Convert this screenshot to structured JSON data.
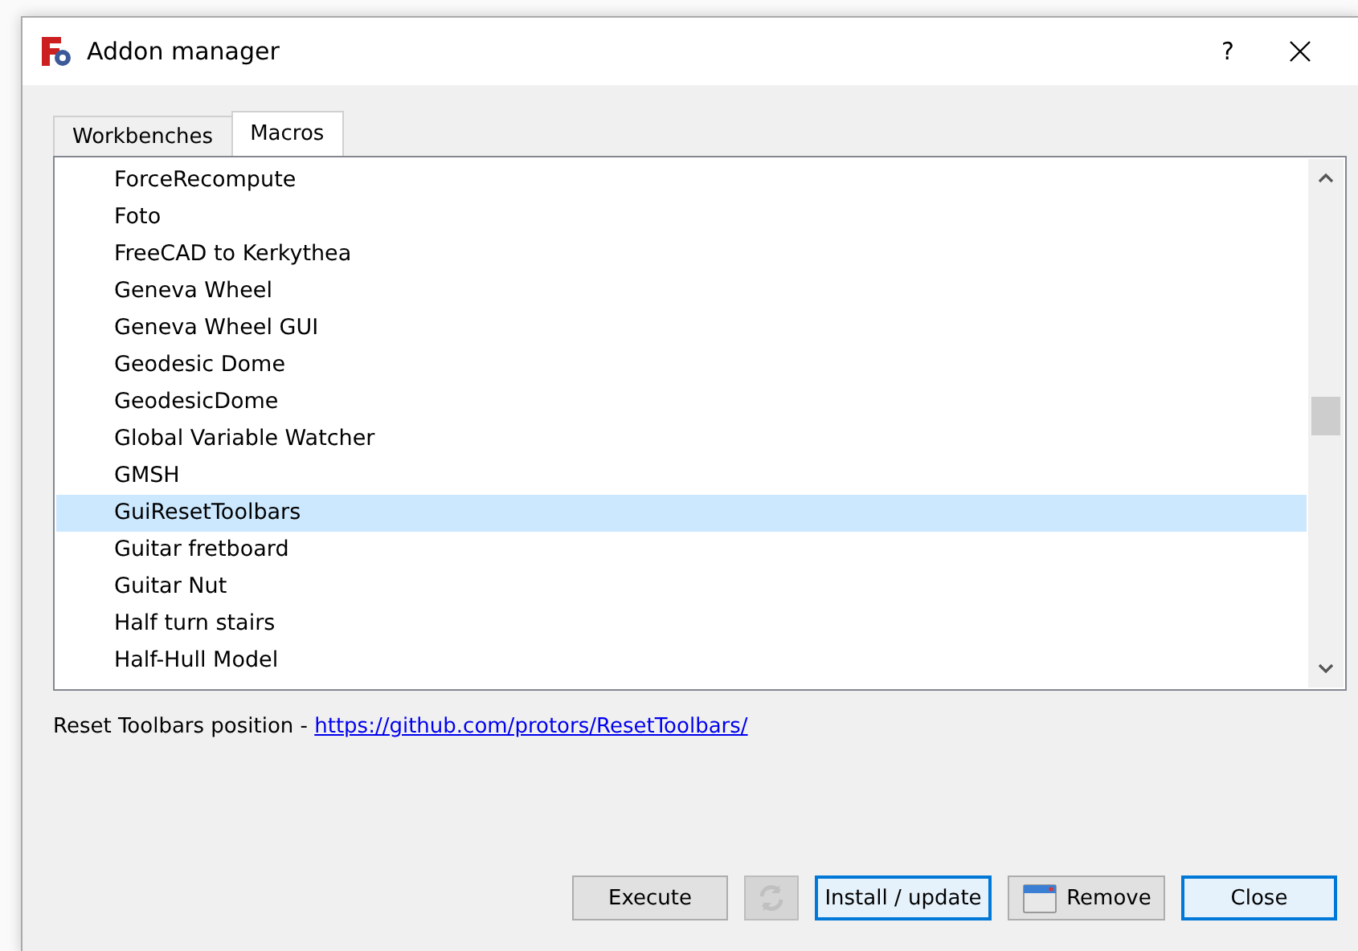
{
  "window": {
    "title": "Addon manager",
    "help": "?"
  },
  "tabs": [
    {
      "label": "Workbenches",
      "selected": false
    },
    {
      "label": "Macros",
      "selected": true
    }
  ],
  "macros": [
    {
      "name": "ForceRecompute",
      "selected": false
    },
    {
      "name": "Foto",
      "selected": false
    },
    {
      "name": "FreeCAD to Kerkythea",
      "selected": false
    },
    {
      "name": "Geneva Wheel",
      "selected": false
    },
    {
      "name": "Geneva Wheel GUI",
      "selected": false
    },
    {
      "name": "Geodesic Dome",
      "selected": false
    },
    {
      "name": "GeodesicDome",
      "selected": false
    },
    {
      "name": "Global Variable Watcher",
      "selected": false
    },
    {
      "name": "GMSH",
      "selected": false
    },
    {
      "name": "GuiResetToolbars",
      "selected": true
    },
    {
      "name": "Guitar fretboard",
      "selected": false
    },
    {
      "name": "Guitar Nut",
      "selected": false
    },
    {
      "name": "Half turn stairs",
      "selected": false
    },
    {
      "name": "Half-Hull Model",
      "selected": false
    }
  ],
  "description": {
    "text": "Reset Toolbars position - ",
    "link": "https://github.com/protors/ResetToolbars/"
  },
  "buttons": [
    {
      "kind": "text",
      "label": "Execute",
      "disabled": false,
      "focused": false
    },
    {
      "kind": "refresh",
      "disabled": true,
      "focused": false
    },
    {
      "kind": "text",
      "label": "Install / update",
      "disabled": false,
      "focused": true
    },
    {
      "kind": "remove",
      "label": "Remove",
      "disabled": false,
      "focused": false
    },
    {
      "kind": "text",
      "label": "Close",
      "disabled": false,
      "focused": true
    }
  ]
}
